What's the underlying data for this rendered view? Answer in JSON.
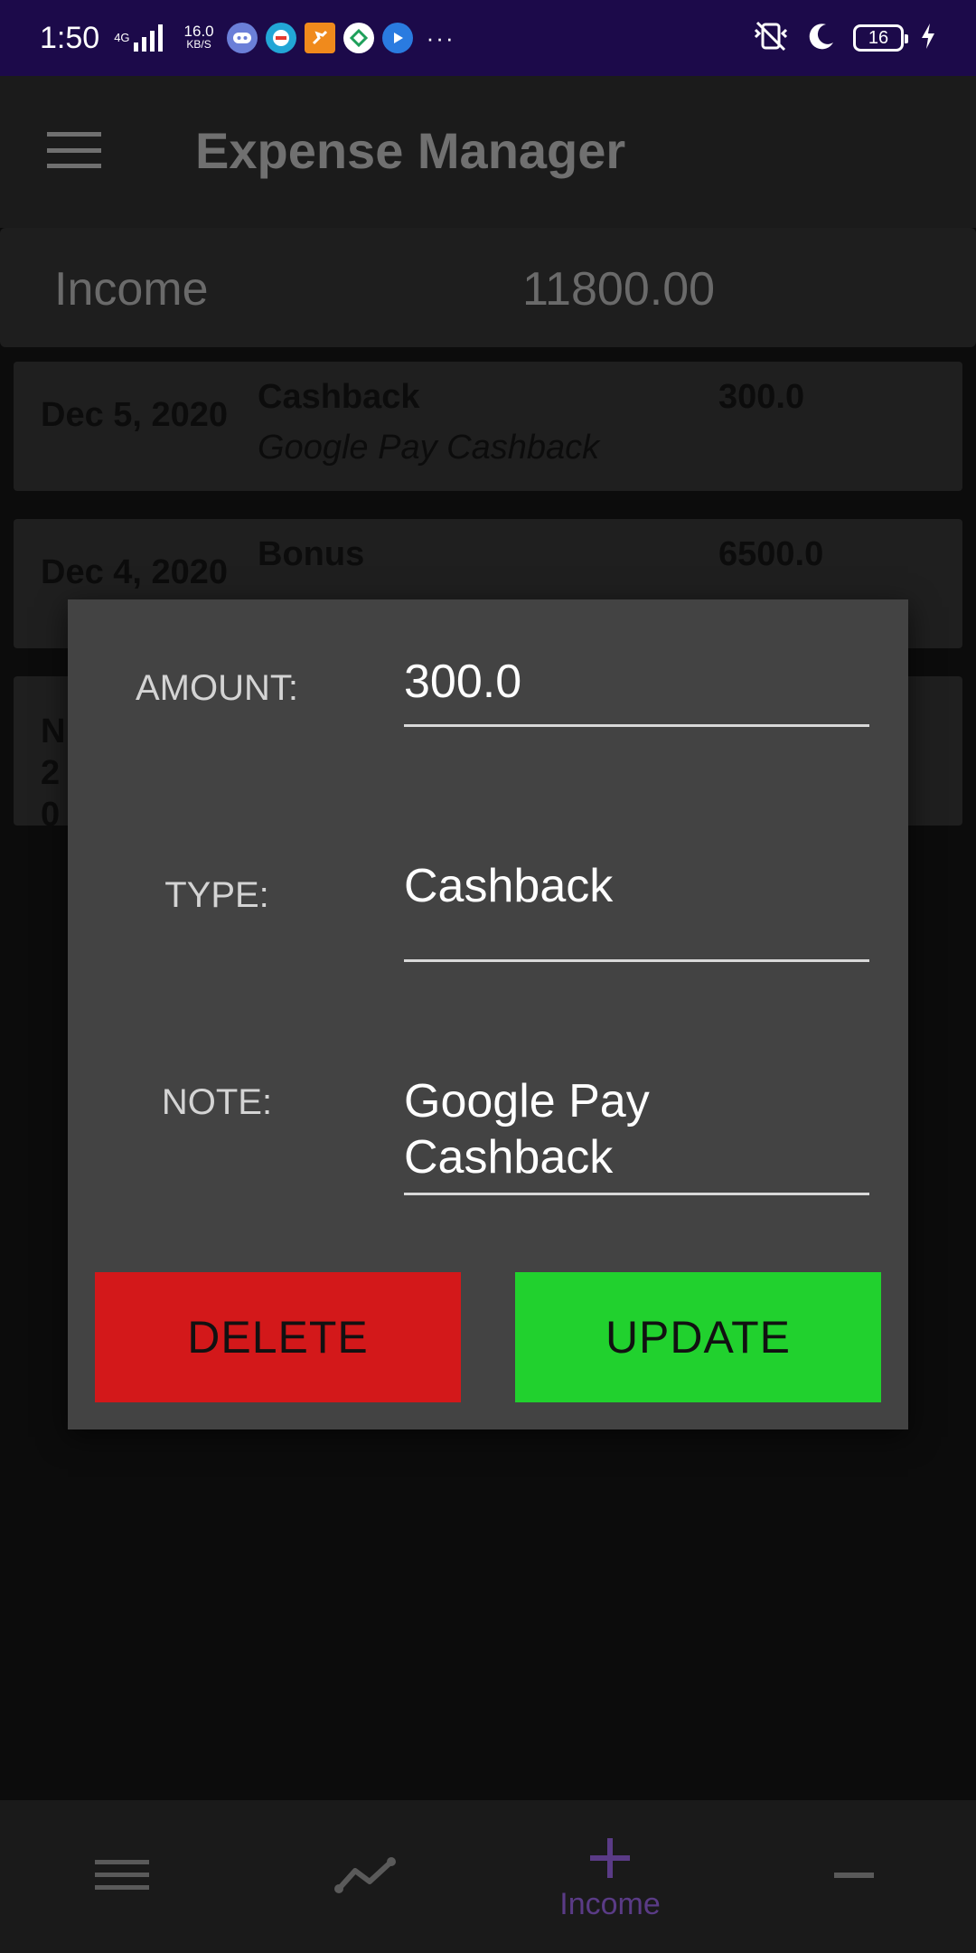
{
  "status_bar": {
    "time": "1:50",
    "network": "4G",
    "speed_value": "16.0",
    "speed_unit": "KB/S",
    "more": "···",
    "battery": "16",
    "app_icons": [
      "discord-icon",
      "app-icon",
      "runner-icon",
      "app-icon",
      "play-icon"
    ],
    "accent": "#1c0a4a"
  },
  "app_bar": {
    "title": "Expense Manager"
  },
  "summary": {
    "label": "Income",
    "value": "11800.00"
  },
  "list": [
    {
      "date": "Dec 5, 2020",
      "type": "Cashback",
      "note": "Google Pay Cashback",
      "amount": "300.0"
    },
    {
      "date": "Dec 4, 2020",
      "type": "Bonus",
      "note": "",
      "amount": "6500.0"
    },
    {
      "date": "N 20",
      "type": "",
      "note": "",
      "amount": ""
    }
  ],
  "dialog": {
    "amount_label": "AMOUNT:",
    "amount_value": "300.0",
    "type_label": "TYPE:",
    "type_value": "Cashback",
    "note_label": "NOTE:",
    "note_value": "Google Pay Cashback",
    "delete_label": "DELETE",
    "update_label": "UPDATE",
    "colors": {
      "delete": "#d3181a",
      "update": "#21d12e"
    }
  },
  "bottom_nav": {
    "items": [
      {
        "icon": "menu-icon"
      },
      {
        "icon": "chart-icon"
      },
      {
        "icon": "plus-icon",
        "label": "Income",
        "active": true
      },
      {
        "icon": "minus-icon"
      }
    ],
    "active_color": "#5a3b86"
  }
}
